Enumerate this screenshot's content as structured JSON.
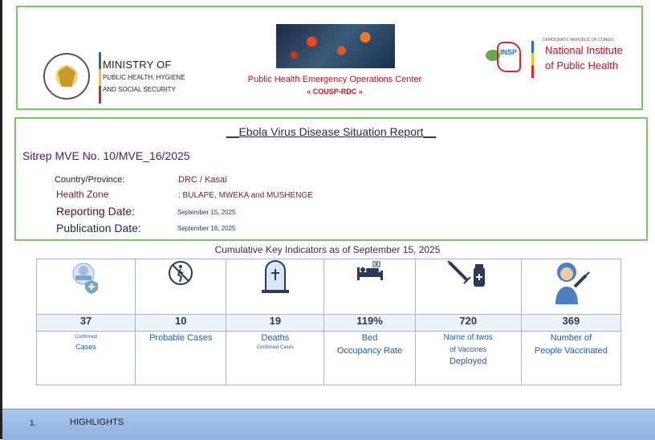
{
  "header": {
    "ministry": {
      "title": "MINISTRY OF",
      "line2": "PUBLIC HEALTH, HYGIENE",
      "line3": "AND SOCIAL SECURITY"
    },
    "seal_text": "REPUBLIQUE DEMOCRATIQUE DU CONGO · LE GOUVERNEMENT",
    "eoc": {
      "title": "Public Health Emergency Operations Center",
      "abbr": "« COUSP-RDC »"
    },
    "insp": {
      "small": "DEMOCRATIC REPUBLIC OF CONGO",
      "logo_text": "INSP",
      "name_line1": "National Institute",
      "name_line2": "of Public Health"
    }
  },
  "report": {
    "title": "__Ebola Virus Disease Situation Report__",
    "sitrep": "Sitrep MVE No. 10/MVE_16/2025",
    "country_label": "Country/Province:",
    "country_value": "DRC / Kasai",
    "zone_label": "Health Zone",
    "zone_value": ": BULAPE, MWEKA and MUSHENGE",
    "reporting_label": "Reporting Date:",
    "reporting_value": "September 15, 2025",
    "publication_label": "Publication Date:",
    "publication_value": "September 18, 2025"
  },
  "indicators": {
    "title": "Cumulative Key Indicators as of September 15, 2025",
    "items": [
      {
        "icon": "patient-shield-icon",
        "value": "37",
        "tiny": "Confirmed",
        "line1": "Cases",
        "line2": ""
      },
      {
        "icon": "no-walking-icon",
        "value": "10",
        "tiny": "",
        "line1": "Probable Cases",
        "line2": ""
      },
      {
        "icon": "grave-icon",
        "value": "19",
        "tiny": "",
        "line1": "Deaths",
        "line2": "Confirmed Cases"
      },
      {
        "icon": "hospital-bed-icon",
        "value": "119%",
        "tiny": "",
        "line1": "Bed",
        "line2": "Occupancy Rate"
      },
      {
        "icon": "syringe-vial-icon",
        "value": "720",
        "tiny": "",
        "line1": "Name of twos",
        "line2": "of Vaccines",
        "line3": "Deployed"
      },
      {
        "icon": "vaccinated-person-icon",
        "value": "369",
        "tiny": "",
        "line1": "Number of",
        "line2": "People Vaccinated"
      }
    ]
  },
  "highlights": {
    "number": "1.",
    "label": "HIGHLIGHTS"
  },
  "colors": {
    "frame_green": "#7ec46a",
    "eoc_red": "#c0121a",
    "label_blue": "#1f5da8",
    "highlights_bg": "#a9c6ea"
  }
}
